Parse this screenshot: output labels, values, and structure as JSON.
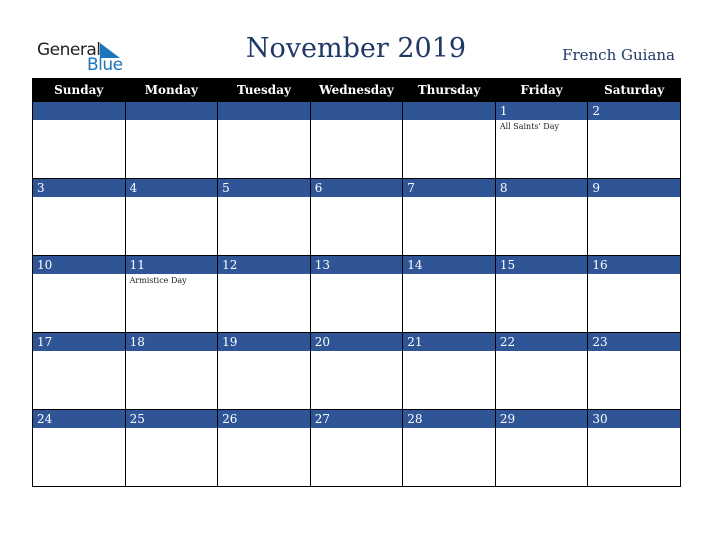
{
  "logo": {
    "word1": "General",
    "word2": "Blue",
    "icon": "triangle-flag-icon",
    "colors": {
      "dark": "#222222",
      "blue": "#1a75bc"
    }
  },
  "header": {
    "title": "November 2019",
    "region": "French Guiana"
  },
  "colors": {
    "title": "#1f3864",
    "weekday_header_bg": "#000000",
    "date_band_bg": "#2f5597",
    "cell_bg": "#ffffff"
  },
  "weekdays": [
    "Sunday",
    "Monday",
    "Tuesday",
    "Wednesday",
    "Thursday",
    "Friday",
    "Saturday"
  ],
  "weeks": [
    [
      {
        "day": "",
        "event": ""
      },
      {
        "day": "",
        "event": ""
      },
      {
        "day": "",
        "event": ""
      },
      {
        "day": "",
        "event": ""
      },
      {
        "day": "",
        "event": ""
      },
      {
        "day": "1",
        "event": "All Saints' Day"
      },
      {
        "day": "2",
        "event": ""
      }
    ],
    [
      {
        "day": "3",
        "event": ""
      },
      {
        "day": "4",
        "event": ""
      },
      {
        "day": "5",
        "event": ""
      },
      {
        "day": "6",
        "event": ""
      },
      {
        "day": "7",
        "event": ""
      },
      {
        "day": "8",
        "event": ""
      },
      {
        "day": "9",
        "event": ""
      }
    ],
    [
      {
        "day": "10",
        "event": ""
      },
      {
        "day": "11",
        "event": "Armistice Day"
      },
      {
        "day": "12",
        "event": ""
      },
      {
        "day": "13",
        "event": ""
      },
      {
        "day": "14",
        "event": ""
      },
      {
        "day": "15",
        "event": ""
      },
      {
        "day": "16",
        "event": ""
      }
    ],
    [
      {
        "day": "17",
        "event": ""
      },
      {
        "day": "18",
        "event": ""
      },
      {
        "day": "19",
        "event": ""
      },
      {
        "day": "20",
        "event": ""
      },
      {
        "day": "21",
        "event": ""
      },
      {
        "day": "22",
        "event": ""
      },
      {
        "day": "23",
        "event": ""
      }
    ],
    [
      {
        "day": "24",
        "event": ""
      },
      {
        "day": "25",
        "event": ""
      },
      {
        "day": "26",
        "event": ""
      },
      {
        "day": "27",
        "event": ""
      },
      {
        "day": "28",
        "event": ""
      },
      {
        "day": "29",
        "event": ""
      },
      {
        "day": "30",
        "event": ""
      }
    ]
  ]
}
